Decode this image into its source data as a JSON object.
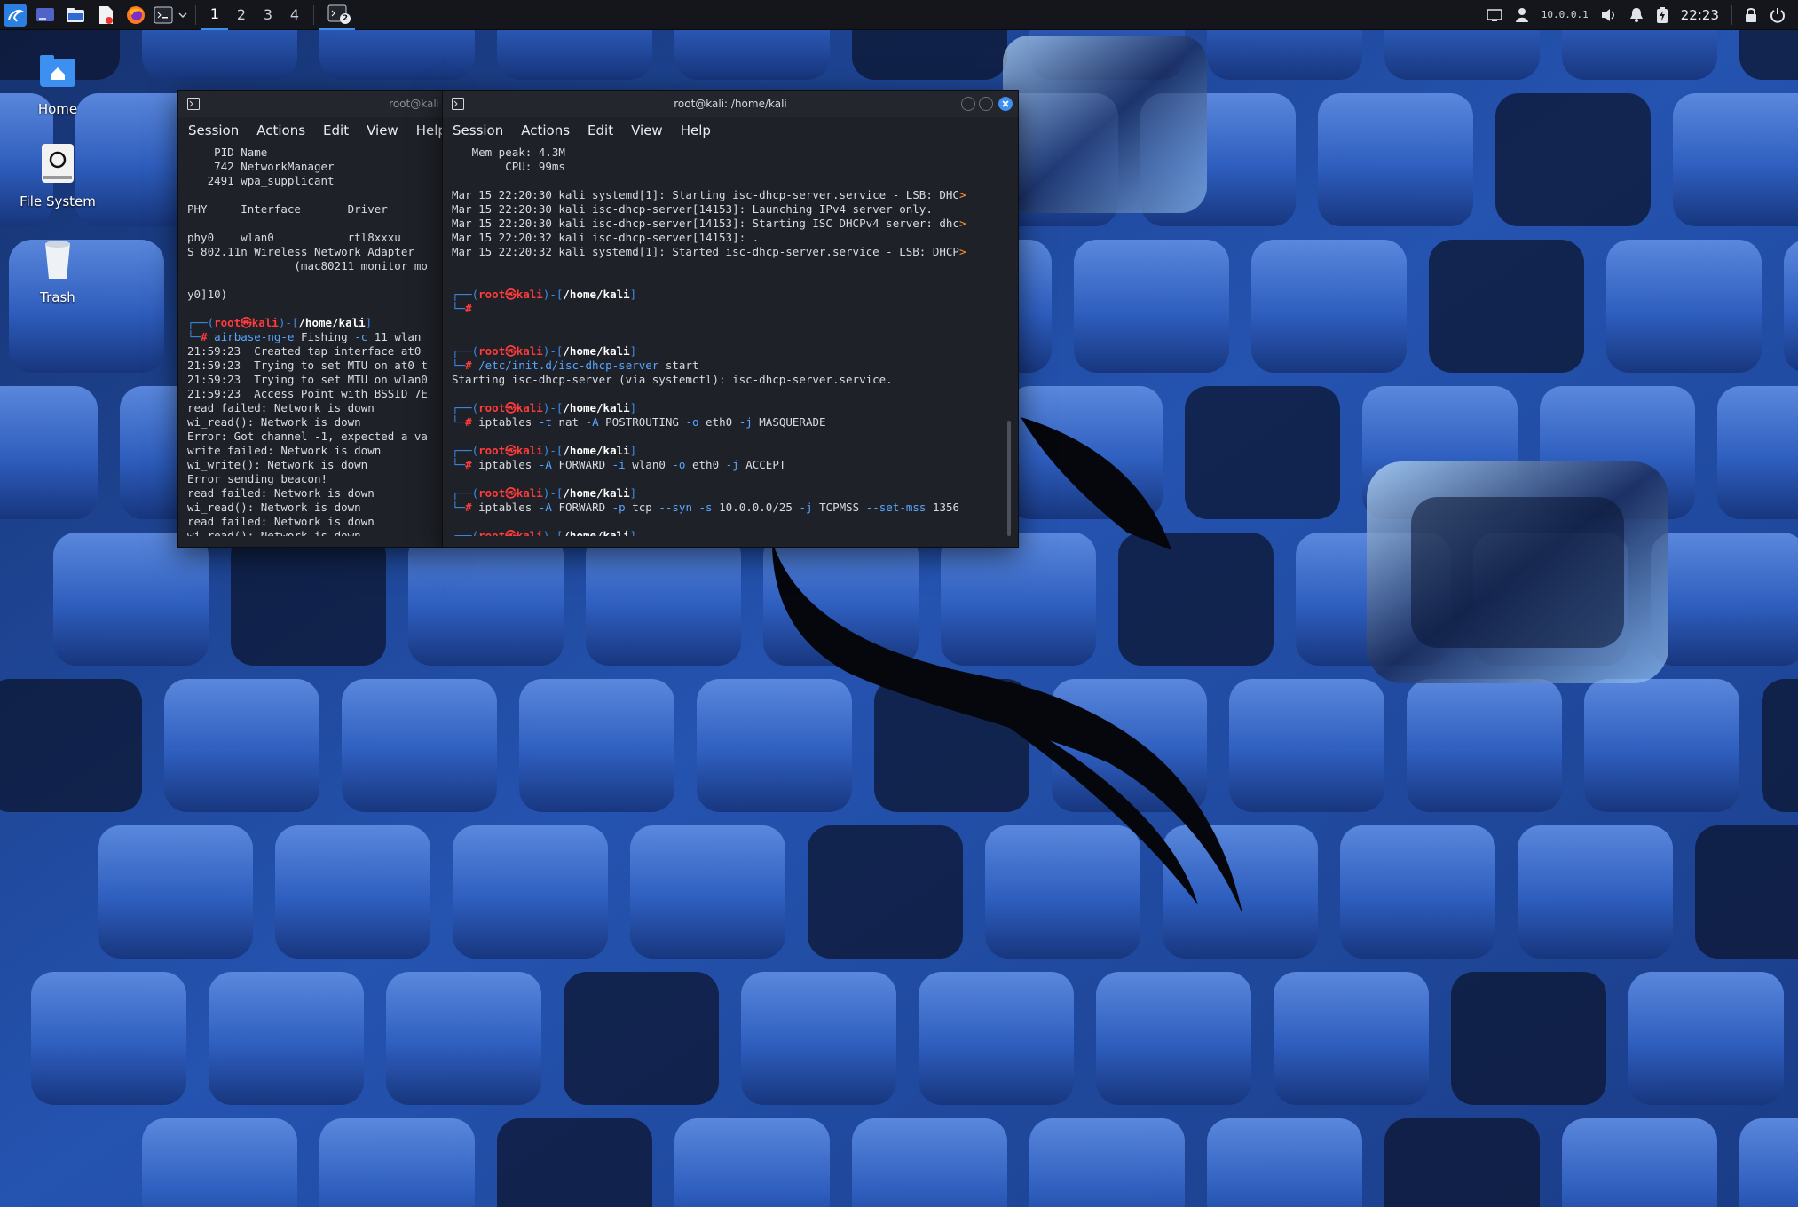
{
  "taskbar": {
    "workspaces": [
      "1",
      "2",
      "3",
      "4"
    ],
    "tray_ip": "10.0.0.1",
    "clock": "22:23",
    "terminal_badge": "2"
  },
  "desktop": {
    "icons": [
      {
        "label": "Home",
        "icon": "home-folder-icon"
      },
      {
        "label": "File System",
        "icon": "drive-icon"
      },
      {
        "label": "Trash",
        "icon": "trash-icon"
      }
    ]
  },
  "left_terminal": {
    "title": "root@kali",
    "menu": [
      "Session",
      "Actions",
      "Edit",
      "View",
      "Help"
    ],
    "lines": [
      "    PID Name",
      "    742 NetworkManager",
      "   2491 wpa_supplicant",
      "",
      "PHY     Interface       Driver",
      "",
      "phy0    wlan0           rtl8xxxu",
      "S 802.11n Wireless Network Adapter",
      "                (mac80211 monitor mo",
      "",
      "y0]10)",
      ""
    ],
    "prompt_user": "root㉿kali",
    "prompt_dir": "/home/kali",
    "command_bin": "airbase-ng",
    "command_args": [
      {
        "text": "-e",
        "style": "cyan"
      },
      {
        "text": " Fishing ",
        "style": "plain"
      },
      {
        "text": "-c",
        "style": "cyan"
      },
      {
        "text": " 11 wlan",
        "style": "plain"
      }
    ],
    "output": [
      "21:59:23  Created tap interface at0",
      "21:59:23  Trying to set MTU on at0 t",
      "21:59:23  Trying to set MTU on wlan0",
      "21:59:23  Access Point with BSSID 7E",
      "read failed: Network is down",
      "wi_read(): Network is down",
      "Error: Got channel -1, expected a va",
      "write failed: Network is down",
      "wi_write(): Network is down",
      "Error sending beacon!",
      "read failed: Network is down",
      "wi_read(): Network is down",
      "read failed: Network is down",
      "wi_read(): Network is down"
    ]
  },
  "right_terminal": {
    "title": "root@kali: /home/kali",
    "menu": [
      "Session",
      "Actions",
      "Edit",
      "View",
      "Help"
    ],
    "status_lines": [
      "   Mem peak: 4.3M",
      "        CPU: 99ms",
      ""
    ],
    "log_lines": [
      {
        "text": "Mar 15 22:20:30 kali systemd[1]: Starting isc-dhcp-server.service - LSB: DHC",
        "more": true
      },
      {
        "text": "Mar 15 22:20:30 kali isc-dhcp-server[14153]: Launching IPv4 server only.",
        "more": false
      },
      {
        "text": "Mar 15 22:20:30 kali isc-dhcp-server[14153]: Starting ISC DHCPv4 server: dhc",
        "more": true
      },
      {
        "text": "Mar 15 22:20:32 kali isc-dhcp-server[14153]: .",
        "more": false
      },
      {
        "text": "Mar 15 22:20:32 kali systemd[1]: Started isc-dhcp-server.service - LSB: DHCP",
        "more": true
      }
    ],
    "prompt_user": "root㉿kali",
    "prompt_dir": "/home/kali",
    "commands": [
      {
        "parts": [],
        "output": ""
      },
      {
        "parts": [
          {
            "text": "/etc/init.d/isc-dhcp-server",
            "style": "cyan"
          },
          {
            "text": " start",
            "style": "plain"
          }
        ],
        "output": "Starting isc-dhcp-server (via systemctl): isc-dhcp-server.service."
      },
      {
        "parts": [
          {
            "text": "iptables ",
            "style": "plain"
          },
          {
            "text": "-t",
            "style": "cyan"
          },
          {
            "text": " nat ",
            "style": "plain"
          },
          {
            "text": "-A",
            "style": "cyan"
          },
          {
            "text": " POSTROUTING ",
            "style": "plain"
          },
          {
            "text": "-o",
            "style": "cyan"
          },
          {
            "text": " eth0 ",
            "style": "plain"
          },
          {
            "text": "-j",
            "style": "cyan"
          },
          {
            "text": " MASQUERADE",
            "style": "plain"
          }
        ],
        "output": ""
      },
      {
        "parts": [
          {
            "text": "iptables ",
            "style": "plain"
          },
          {
            "text": "-A",
            "style": "cyan"
          },
          {
            "text": " FORWARD ",
            "style": "plain"
          },
          {
            "text": "-i",
            "style": "cyan"
          },
          {
            "text": " wlan0 ",
            "style": "plain"
          },
          {
            "text": "-o",
            "style": "cyan"
          },
          {
            "text": " eth0 ",
            "style": "plain"
          },
          {
            "text": "-j",
            "style": "cyan"
          },
          {
            "text": " ACCEPT",
            "style": "plain"
          }
        ],
        "output": ""
      },
      {
        "parts": [
          {
            "text": "iptables ",
            "style": "plain"
          },
          {
            "text": "-A",
            "style": "cyan"
          },
          {
            "text": " FORWARD ",
            "style": "plain"
          },
          {
            "text": "-p",
            "style": "cyan"
          },
          {
            "text": " tcp ",
            "style": "plain"
          },
          {
            "text": "--syn",
            "style": "cyan"
          },
          {
            "text": " ",
            "style": "plain"
          },
          {
            "text": "-s",
            "style": "cyan"
          },
          {
            "text": " 10.0.0.0/25 ",
            "style": "plain"
          },
          {
            "text": "-j",
            "style": "cyan"
          },
          {
            "text": " TCPMSS ",
            "style": "plain"
          },
          {
            "text": "--set-mss",
            "style": "cyan"
          },
          {
            "text": " 1356",
            "style": "plain"
          }
        ],
        "output": ""
      }
    ]
  }
}
